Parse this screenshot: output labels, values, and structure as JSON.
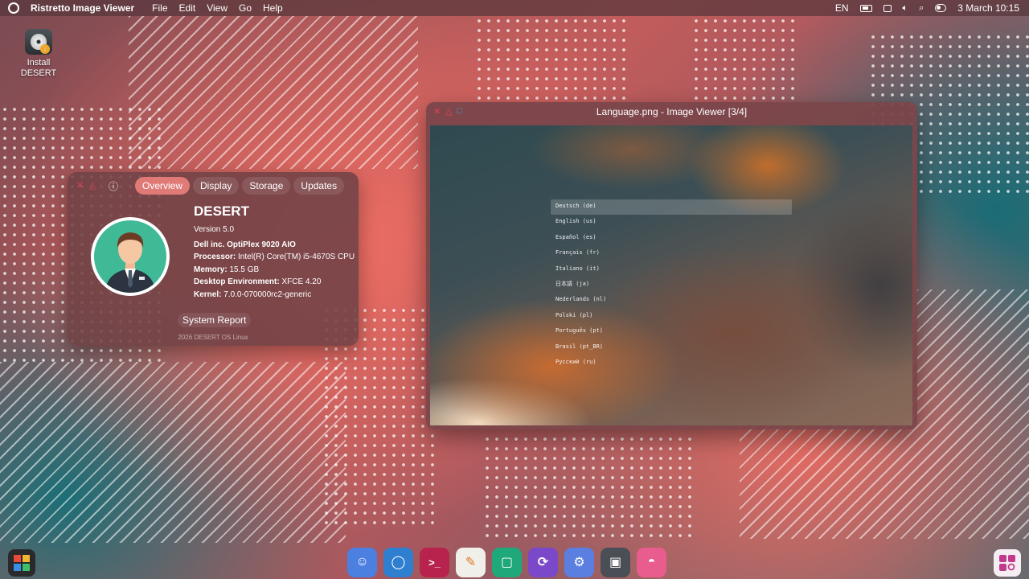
{
  "topbar": {
    "app_name": "Ristretto Image Viewer",
    "menu": [
      "File",
      "Edit",
      "View",
      "Go",
      "Help"
    ],
    "keyboard_layout": "EN",
    "datetime": "3 March 10:15"
  },
  "desktop": {
    "install_icon_label": "Install\nDESERT"
  },
  "about": {
    "close_glyph": "✕",
    "minimize_glyph": "△",
    "info_glyph": "ⓘ",
    "tabs": [
      {
        "label": "Overview",
        "active": true
      },
      {
        "label": "Display",
        "active": false
      },
      {
        "label": "Storage",
        "active": false
      },
      {
        "label": "Updates",
        "active": false
      }
    ],
    "os_name": "DESERT",
    "version": "Version 5.0",
    "device": "Dell inc. OptiPlex 9020 AIO",
    "processor_label": "Processor:",
    "processor_value": "Intel(R) Core(TM) i5-4670S CPU",
    "memory_label": "Memory:",
    "memory_value": "15.5 GB",
    "desktop_env_label": "Desktop Environment:",
    "desktop_env_value": "XFCE 4.20",
    "kernel_label": "Kernel:",
    "kernel_value": "7.0.0-070000rc2-generic",
    "system_report": "System Report",
    "copyright": "2026 DESERT OS Linux"
  },
  "viewer": {
    "title": "Language.png - Image Viewer [3/4]",
    "close_glyph": "✕",
    "minimize_glyph": "△",
    "maximize_glyph": "□",
    "languages": [
      "Deutsch (de)",
      "English (us)",
      "Español (es)",
      "Français (fr)",
      "Italiano (it)",
      "日本語 (ja)",
      "Nederlands (nl)",
      "Polski (pl)",
      "Português (pt)",
      "Brasil (pt_BR)",
      "Русский (ru)"
    ],
    "selected_language": "Deutsch (de)"
  },
  "dock": {
    "items": [
      {
        "icon": "finder-face-icon",
        "glyph": "☺",
        "color": "#4b7fe0"
      },
      {
        "icon": "browser-icon",
        "glyph": "◯",
        "color": "#2f7fd0"
      },
      {
        "icon": "terminal-icon",
        "glyph": ">_",
        "color": "#b7234c"
      },
      {
        "icon": "text-editor-icon",
        "glyph": "✎",
        "color": "#f1efea"
      },
      {
        "icon": "screenshot-icon",
        "glyph": "▢",
        "color": "#1fa87a"
      },
      {
        "icon": "sync-icon",
        "glyph": "⟳",
        "color": "#7b48c9"
      },
      {
        "icon": "settings-gear-icon",
        "glyph": "⚙",
        "color": "#5b7fe0"
      },
      {
        "icon": "chip-icon",
        "glyph": "▣",
        "color": "#4a4f55"
      },
      {
        "icon": "image-viewer-icon",
        "glyph": "◓",
        "color": "#e85c8e"
      }
    ]
  },
  "colors": {
    "accent": "#e07a76",
    "avatar_bg": "#3fb996"
  }
}
